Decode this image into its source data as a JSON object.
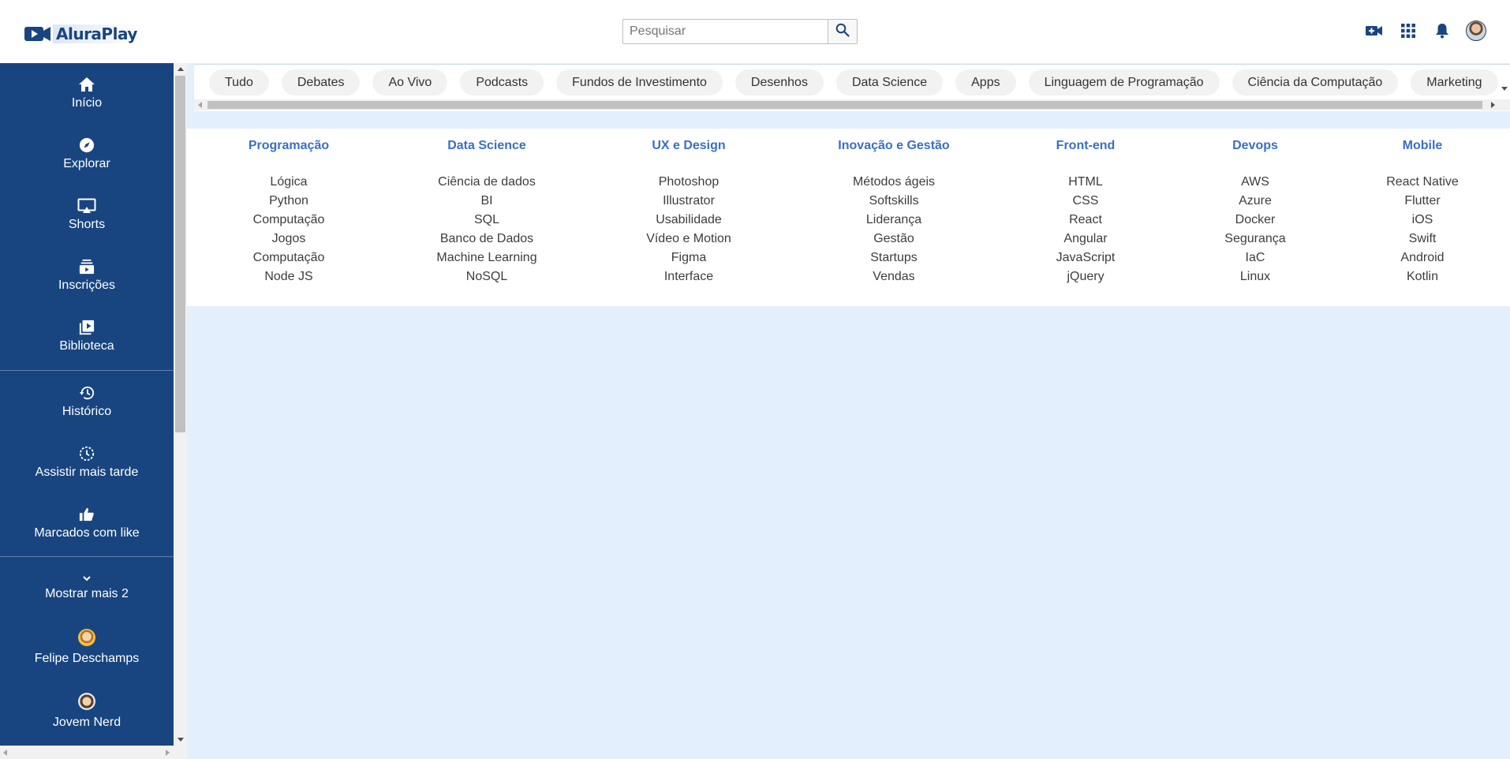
{
  "header": {
    "logo_text": "AluraPlay",
    "search_placeholder": "Pesquisar",
    "icons": [
      "search-icon",
      "video-add-icon",
      "apps-grid-icon",
      "bell-icon",
      "user-avatar"
    ]
  },
  "sidebar": {
    "items": [
      {
        "label": "Início",
        "icon": "home-icon"
      },
      {
        "label": "Explorar",
        "icon": "compass-icon"
      },
      {
        "label": "Shorts",
        "icon": "cast-icon"
      },
      {
        "label": "Inscrições",
        "icon": "subscriptions-icon"
      },
      {
        "label": "Biblioteca",
        "icon": "library-icon"
      },
      {
        "label": "Histórico",
        "icon": "history-icon"
      },
      {
        "label": "Assistir mais tarde",
        "icon": "clock-icon"
      },
      {
        "label": "Marcados com like",
        "icon": "thumbs-up-icon"
      },
      {
        "label": "Mostrar mais 2",
        "icon": "chevron-down-icon"
      },
      {
        "label": "Felipe Deschamps",
        "icon": "channel-avatar"
      },
      {
        "label": "Jovem Nerd",
        "icon": "channel-avatar"
      }
    ]
  },
  "chips": [
    "Tudo",
    "Debates",
    "Ao Vivo",
    "Podcasts",
    "Fundos de Investimento",
    "Desenhos",
    "Data Science",
    "Apps",
    "Linguagem de Programação",
    "Ciência da Computação",
    "Marketing"
  ],
  "categories": [
    {
      "title": "Programação",
      "links": [
        "Lógica",
        "Python",
        "Computação",
        "Jogos",
        "Computação",
        "Node JS"
      ]
    },
    {
      "title": "Data Science",
      "links": [
        "Ciência de dados",
        "BI",
        "SQL",
        "Banco de Dados",
        "Machine Learning",
        "NoSQL"
      ]
    },
    {
      "title": "UX e Design",
      "links": [
        "Photoshop",
        "Illustrator",
        "Usabilidade",
        "Vídeo e Motion",
        "Figma",
        "Interface"
      ]
    },
    {
      "title": "Inovação e Gestão",
      "links": [
        "Métodos ágeis",
        "Softskills",
        "Liderança",
        "Gestão",
        "Startups",
        "Vendas"
      ]
    },
    {
      "title": "Front-end",
      "links": [
        "HTML",
        "CSS",
        "React",
        "Angular",
        "JavaScript",
        "jQuery"
      ]
    },
    {
      "title": "Devops",
      "links": [
        "AWS",
        "Azure",
        "Docker",
        "Segurança",
        "IaC",
        "Linux"
      ]
    },
    {
      "title": "Mobile",
      "links": [
        "React Native",
        "Flutter",
        "iOS",
        "Swift",
        "Android",
        "Kotlin"
      ]
    }
  ],
  "colors": {
    "sidebar_bg": "#18457f",
    "category_title": "#3a6fc4",
    "page_bg": "#e3effc"
  }
}
